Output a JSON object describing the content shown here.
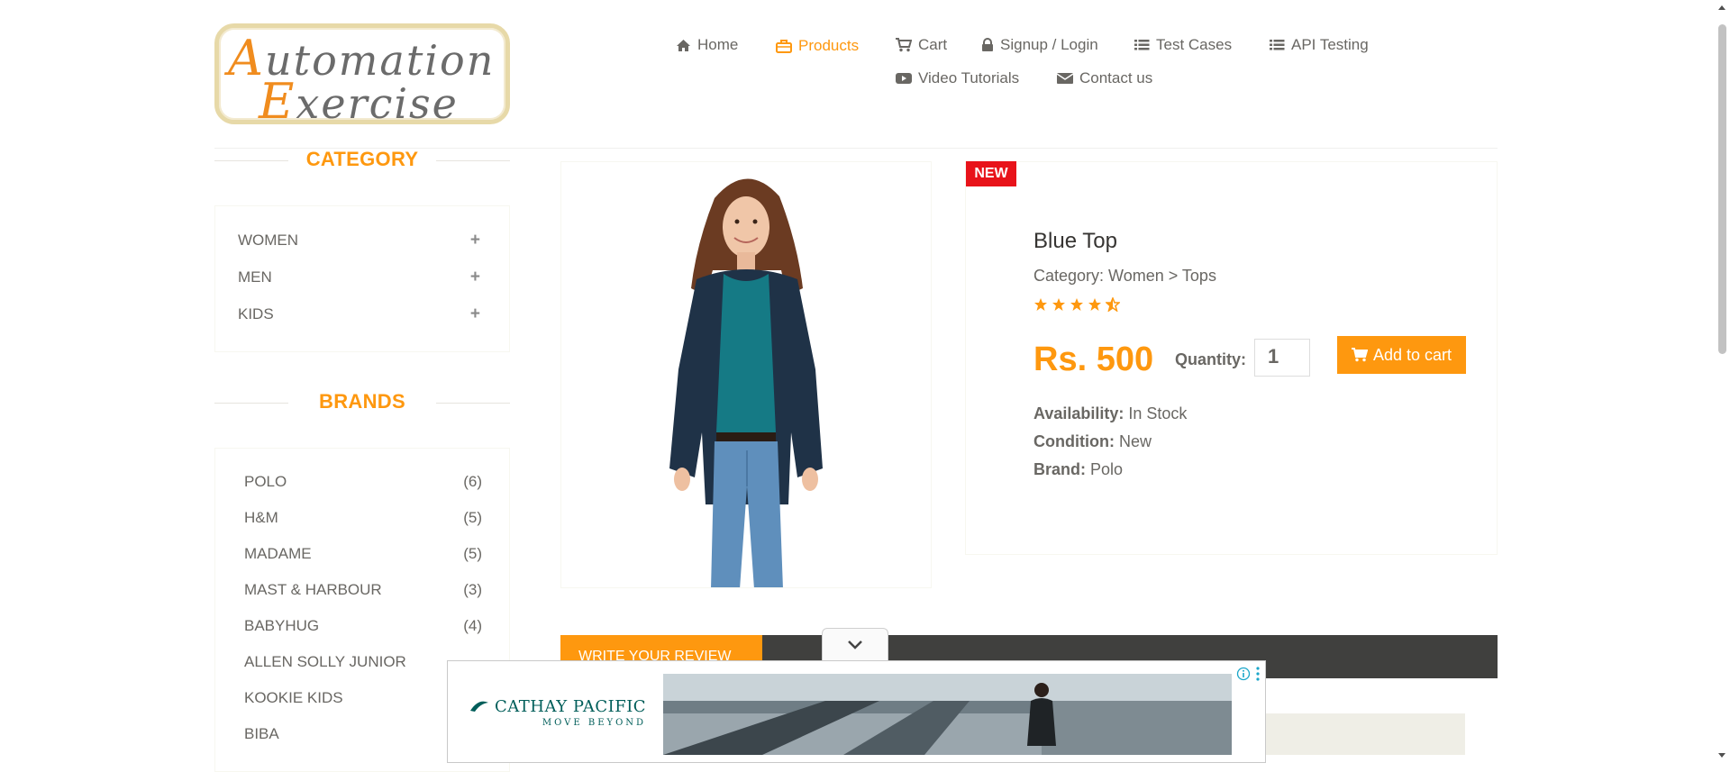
{
  "logo": {
    "line1": "Automation",
    "line2": "Exercise"
  },
  "nav": {
    "items": [
      {
        "label": "Home",
        "icon": "home-icon"
      },
      {
        "label": "Products",
        "icon": "briefcase-icon",
        "active": true
      },
      {
        "label": "Cart",
        "icon": "cart-icon"
      },
      {
        "label": "Signup / Login",
        "icon": "lock-icon"
      },
      {
        "label": "Test Cases",
        "icon": "list-icon"
      },
      {
        "label": "API Testing",
        "icon": "list-icon"
      },
      {
        "label": "Video Tutorials",
        "icon": "youtube-icon"
      },
      {
        "label": "Contact us",
        "icon": "envelope-icon"
      }
    ]
  },
  "sidebar": {
    "category_title": "CATEGORY",
    "categories": [
      {
        "label": "WOMEN",
        "toggle": "+"
      },
      {
        "label": "MEN",
        "toggle": "+"
      },
      {
        "label": "KIDS",
        "toggle": "+"
      }
    ],
    "brands_title": "BRANDS",
    "brands": [
      {
        "label": "POLO",
        "count": "(6)"
      },
      {
        "label": "H&M",
        "count": "(5)"
      },
      {
        "label": "MADAME",
        "count": "(5)"
      },
      {
        "label": "MAST & HARBOUR",
        "count": "(3)"
      },
      {
        "label": "BABYHUG",
        "count": "(4)"
      },
      {
        "label": "ALLEN SOLLY JUNIOR",
        "count": ""
      },
      {
        "label": "KOOKIE KIDS",
        "count": ""
      },
      {
        "label": "BIBA",
        "count": ""
      }
    ]
  },
  "product": {
    "badge": "NEW",
    "name": "Blue Top",
    "category": "Category: Women > Tops",
    "rating": 4.5,
    "price": "Rs. 500",
    "quantity_label": "Quantity:",
    "quantity_value": "1",
    "add_to_cart": "Add to cart",
    "availability_label": "Availability:",
    "availability": "In Stock",
    "condition_label": "Condition:",
    "condition": "New",
    "brand_label": "Brand:",
    "brand": "Polo"
  },
  "review": {
    "tab_label": "Write Your Review"
  },
  "ad": {
    "brand": "CATHAY PACIFIC",
    "tagline": "MOVE BEYOND"
  },
  "colors": {
    "accent": "#FE980F",
    "badge": "#e8131a",
    "tab_bar": "#40403e",
    "ad_brand": "#005e5a"
  }
}
